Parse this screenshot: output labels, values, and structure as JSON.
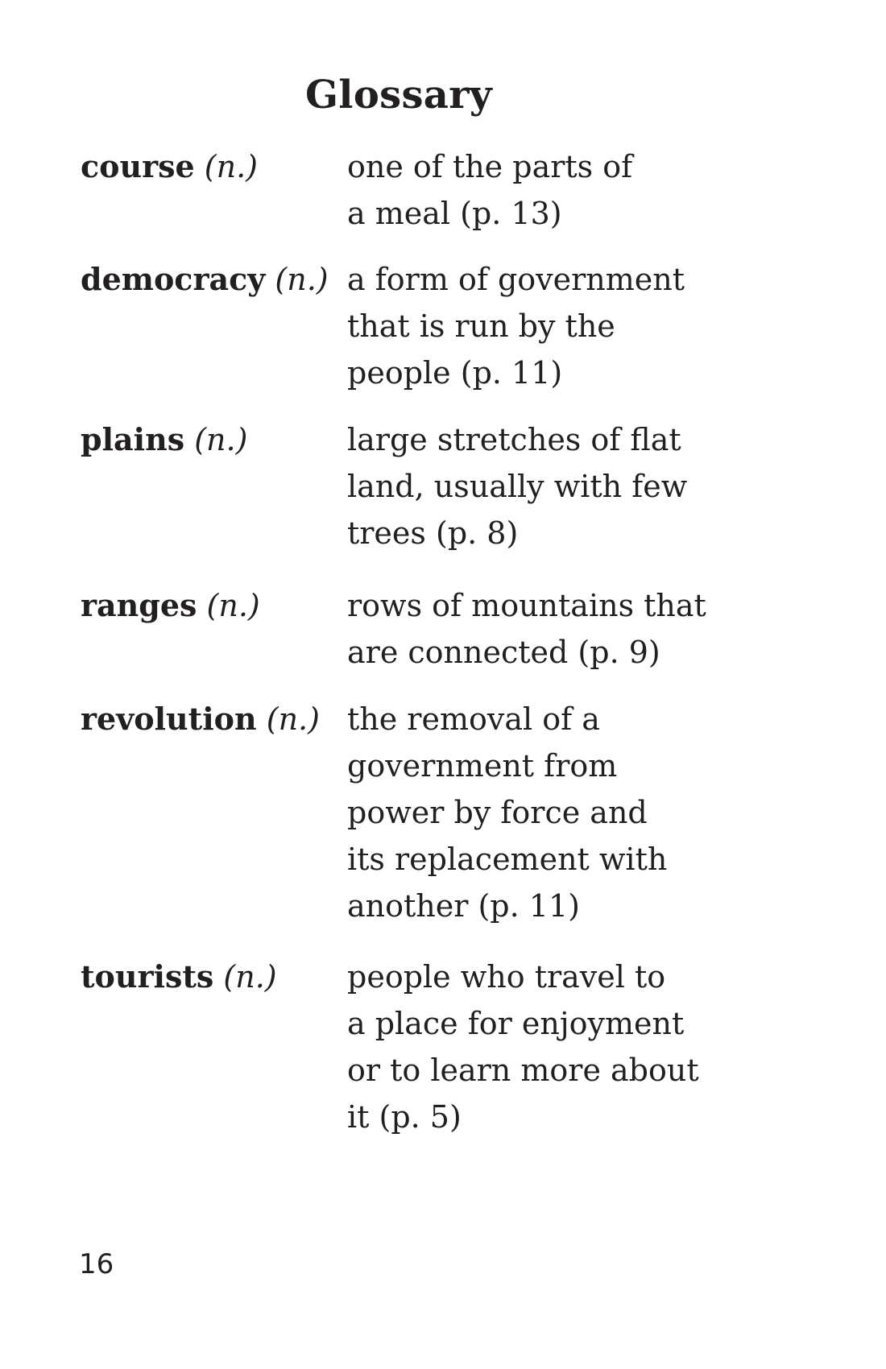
{
  "title": "Glossary",
  "entries": [
    {
      "term": "course",
      "pos": "(n.)",
      "definition_lines": [
        "one of the parts of",
        "a meal (p. 13)"
      ]
    },
    {
      "term": "democracy",
      "pos": "(n.)",
      "definition_lines": [
        "a form of government",
        "that is run by the",
        "people (p. 11)"
      ]
    },
    {
      "term": "plains",
      "pos": "(n.)",
      "definition_lines": [
        "large stretches of flat",
        "land, usually with few",
        "trees (p. 8)"
      ]
    },
    {
      "term": "ranges",
      "pos": "(n.)",
      "definition_lines": [
        "rows of mountains that",
        "are connected (p. 9)"
      ]
    },
    {
      "term": "revolution",
      "pos": "(n.)",
      "definition_lines": [
        "the removal of a",
        "government from",
        "power by force and",
        "its replacement with",
        "another (p. 11)"
      ]
    },
    {
      "term": "tourists",
      "pos": "(n.)",
      "definition_lines": [
        "people who travel to",
        "a place for enjoyment",
        "or to learn more about",
        "it (p. 5)"
      ]
    }
  ],
  "page_number": "16"
}
